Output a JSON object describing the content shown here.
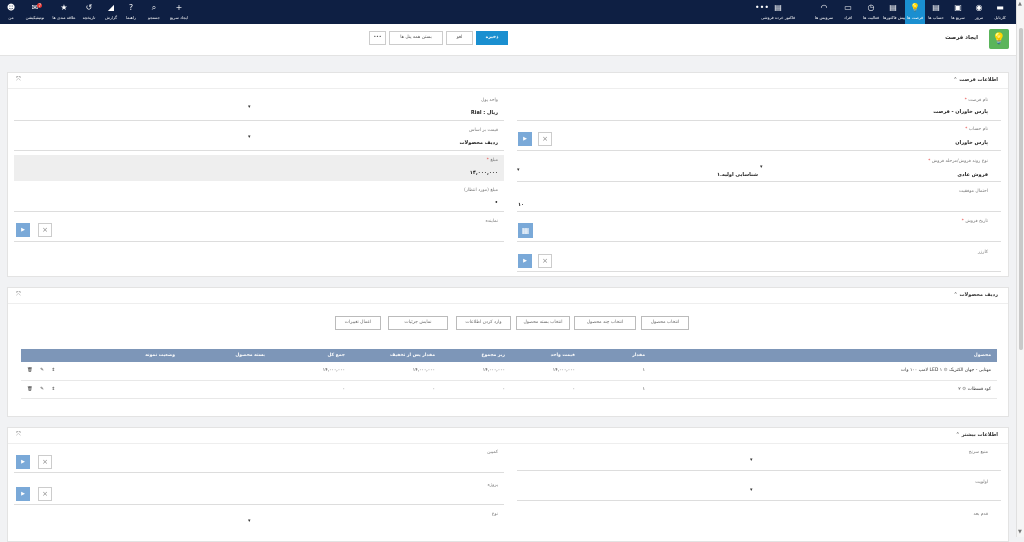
{
  "nav": {
    "right_items": [
      {
        "label": "کارتابل",
        "icon": "cartable-icon",
        "glyph": "▬"
      },
      {
        "label": "مرور",
        "icon": "browse-icon",
        "glyph": "◉"
      },
      {
        "label": "سریع ها",
        "icon": "quick-icon",
        "glyph": "▣"
      },
      {
        "label": "حساب ها",
        "icon": "accounts-icon",
        "glyph": "▤"
      },
      {
        "label": "فرصت ها",
        "icon": "lightbulb-icon",
        "glyph": "💡"
      },
      {
        "label": "پیش فاکتورها",
        "icon": "proforma-icon",
        "glyph": "▤"
      },
      {
        "label": "فعالیت ها",
        "icon": "activities-icon",
        "glyph": "◷"
      },
      {
        "label": "افراد",
        "icon": "people-icon",
        "glyph": "▭"
      },
      {
        "label": "سرویس ها",
        "icon": "headset-icon",
        "glyph": "◠"
      },
      {
        "label": "فاکتور خرده فروشی",
        "icon": "invoice-icon",
        "glyph": "▤"
      },
      {
        "label": "",
        "icon": "more-icon",
        "glyph": "•••"
      }
    ],
    "left_items": [
      {
        "label": "ایجاد سریع",
        "icon": "plus-icon",
        "glyph": "+"
      },
      {
        "label": "جستجو",
        "icon": "search-icon",
        "glyph": "⌕"
      },
      {
        "label": "راهنما",
        "icon": "help-icon",
        "glyph": "?"
      },
      {
        "label": "گزارش",
        "icon": "report-icon",
        "glyph": "◢"
      },
      {
        "label": "تاریخچه",
        "icon": "history-icon",
        "glyph": "↺"
      },
      {
        "label": "علاقه مندی ها",
        "icon": "star-icon",
        "glyph": "★"
      },
      {
        "label": "نوتیفیکیشن",
        "icon": "notification-icon",
        "glyph": "✉",
        "badge": "7"
      },
      {
        "label": "من",
        "icon": "user-avatar-icon",
        "glyph": "☻"
      }
    ]
  },
  "header": {
    "title": "ایجاد فرصت",
    "save": "ذخیره",
    "cancel": "لغو",
    "close_all": "بستن همه پنل ها",
    "more": "•••"
  },
  "section1": {
    "title": "اطلاعات فرصت",
    "opportunity_name_label": "نام فرصت",
    "opportunity_name": "پارس خاوران - فرصت",
    "account_name_label": "نام حساب",
    "account_name": "پارس خاوران",
    "sales_process_label": "نوع روند فروش/مرحله فروش",
    "sales_process": "فروش عادی",
    "sales_stage": "۱.شناسایی اولیه",
    "success_prob_label": "احتمال موفقیت",
    "success_prob": "۱۰",
    "sale_date_label": "تاریخ فروش",
    "campaign_label": "کارزر",
    "currency_label": "واحد پول",
    "currency": "Rial : ریال",
    "price_basis_label": "قیمت بر اساس",
    "price_basis": "ردیف محصولات",
    "amount_label": "مبلغ",
    "amount": "۱۴,۰۰۰,۰۰۰",
    "expected_amount_label": "مبلغ (مورد انتظار)",
    "representative_label": "نماینده"
  },
  "section2": {
    "title": "ردیف محصولات",
    "buttons": [
      "انتخاب محصول",
      "انتخاب چند محصول",
      "انتخاب بسته محصول",
      "وارد کردن اطلاعات",
      "نمایش جزئیات",
      "اعمال تغییرات"
    ],
    "columns": [
      "محصول",
      "مقدار",
      "قیمت واحد",
      "زیر مجموع",
      "مقدار پس از تخفیف",
      "جمع کل",
      "بسته محصول",
      "وضعیت نمونه"
    ],
    "rows": [
      {
        "num": "۱",
        "product": "لامپ ۱۰۰ وات LED مهتابی - جهان الکتریک",
        "qty": "۱",
        "unit": "۱۴,۰۰۰,۰۰۰",
        "sub": "۱۴,۰۰۰,۰۰۰",
        "after": "۱۴,۰۰۰,۰۰۰",
        "total": "۱۴,۰۰۰,۰۰۰",
        "bundle": "",
        "status": ""
      },
      {
        "num": "۲",
        "product": "کود قسطات",
        "qty": "۱",
        "unit": "۰",
        "sub": "۰",
        "after": "۰",
        "total": "۰",
        "bundle": "",
        "status": ""
      }
    ]
  },
  "section3": {
    "title": "اطلاعات بیشتر",
    "source_label": "منبع سرنخ",
    "campaign_label": "کمپین",
    "priority_label": "اولویت",
    "project_label": "پروژه",
    "next_step_label": "قدم بعد",
    "type_label": "نوع"
  },
  "colors": {
    "nav": "#0e1f43",
    "accent": "#1a8fd0",
    "table_header": "#7d96b8",
    "lookup": "#7aa9d8"
  }
}
